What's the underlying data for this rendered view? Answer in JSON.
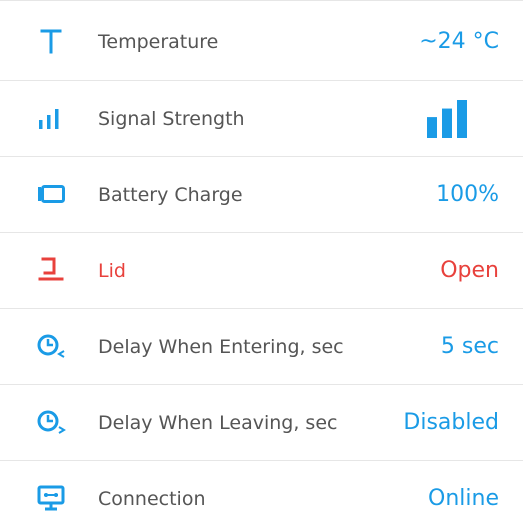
{
  "colors": {
    "accent": "#1a9be6",
    "alert": "#e8413c",
    "label": "#555555",
    "divider": "#e6e6e6"
  },
  "rows": [
    {
      "icon": "temperature-icon",
      "label": "Temperature",
      "value": "~24 °C",
      "status": "normal"
    },
    {
      "icon": "signal-strength-icon",
      "label": "Signal Strength",
      "value_icon": "signal-bars-icon",
      "signal_level": 3,
      "signal_max": 3,
      "status": "normal"
    },
    {
      "icon": "battery-icon",
      "label": "Battery Charge",
      "value": "100%",
      "status": "normal"
    },
    {
      "icon": "lid-icon",
      "label": "Lid",
      "value": "Open",
      "status": "alert"
    },
    {
      "icon": "clock-enter-icon",
      "label": "Delay When Entering, sec",
      "value": "5 sec",
      "status": "normal"
    },
    {
      "icon": "clock-leave-icon",
      "label": "Delay When Leaving, sec",
      "value": "Disabled",
      "status": "normal"
    },
    {
      "icon": "connection-icon",
      "label": "Connection",
      "value": "Online",
      "status": "normal"
    }
  ]
}
